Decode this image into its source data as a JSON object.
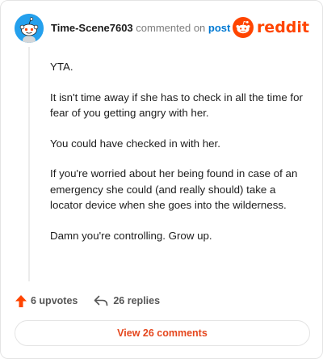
{
  "header": {
    "username": "Time-Scene7603",
    "action_text": "commented on",
    "post_link": "post",
    "brand_word": "reddit",
    "brand_color": "#ff4500"
  },
  "comment": {
    "paragraphs": [
      "YTA.",
      "It isn't time away if she has to check in all the time for fear of you getting angry with her.",
      "You could have checked in with her.",
      "If you're worried about her being found in case of an emergency she could (and really should) take a locator device when she goes into the wilderness.",
      "Damn you're controlling. Grow up."
    ]
  },
  "actions": {
    "upvotes": "6 upvotes",
    "replies": "26 replies",
    "upvote_icon": "upvote-arrow-icon",
    "reply_icon": "reply-arrow-icon",
    "upvote_color": "#ff4500"
  },
  "footer": {
    "view_comments": "View 26 comments",
    "button_text_color": "#e5471e"
  },
  "avatar": {
    "icon": "snoo-avatar-icon",
    "background": "#24a0ed"
  }
}
